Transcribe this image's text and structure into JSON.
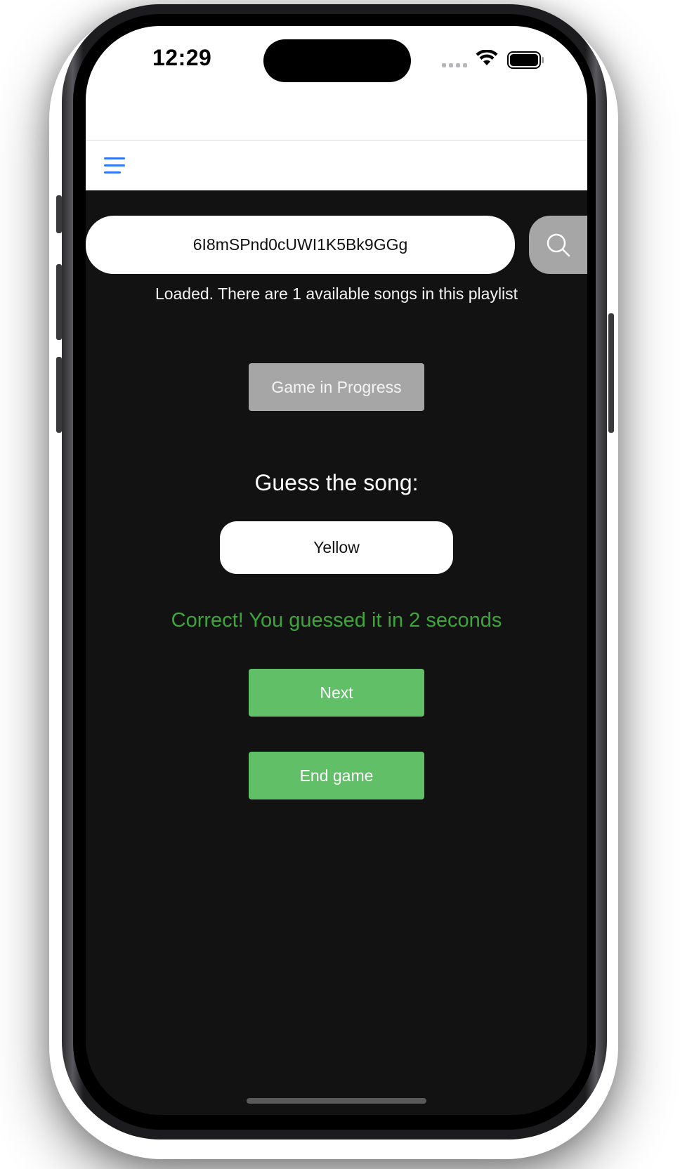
{
  "status_bar": {
    "time": "12:29"
  },
  "nav": {
    "menu_icon": "hamburger-menu-icon",
    "accent_color": "#3478f6"
  },
  "search": {
    "value": "6I8mSPnd0cUWI1K5Bk9GGg",
    "button_icon": "search-icon"
  },
  "status_message": "Loaded. There are 1 available songs in this playlist",
  "game": {
    "progress_button_label": "Game in Progress",
    "guess_prompt": "Guess the song:",
    "guess_value": "Yellow",
    "result_message": "Correct! You guessed it in 2 seconds",
    "next_label": "Next",
    "end_label": "End game"
  },
  "colors": {
    "background": "#121212",
    "success_text": "#3ea53a",
    "primary_button": "#61bf67",
    "disabled_button": "#a6a6a6"
  }
}
